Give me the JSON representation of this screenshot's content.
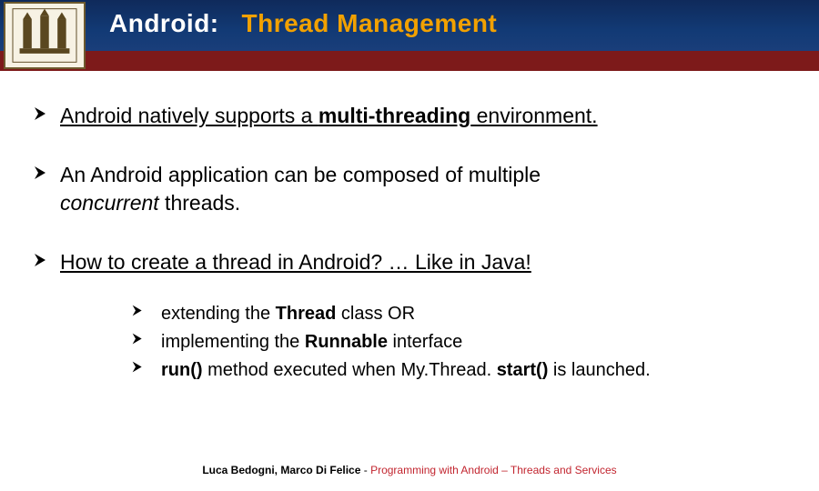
{
  "header": {
    "title_prefix": "Android:",
    "title_accent": "Thread Management"
  },
  "bullets": [
    {
      "plain_pre": "Android natively supports a ",
      "bold_u": "multi-threading",
      "plain_post": " environment.",
      "underline_whole": true
    },
    {
      "line1_pre": "An Android application can be composed of multiple",
      "line2_italic": "concurrent",
      "line2_post": " threads."
    },
    {
      "full_underline": "How to create a thread in Android? … Like in Java!"
    }
  ],
  "sub": [
    {
      "pre": "extending the ",
      "bold": "Thread",
      "post": " class    OR"
    },
    {
      "pre": "implementing the ",
      "bold": "Runnable",
      "post": " interface"
    },
    {
      "pre": "",
      "bold": "run()",
      "mid": " method executed when My.Thread. ",
      "bold2": "start()",
      "post": " is launched."
    }
  ],
  "footer": {
    "authors": "Luca Bedogni, Marco Di Felice",
    "dash": " - ",
    "course": "Programming with Android – Threads and Services"
  }
}
